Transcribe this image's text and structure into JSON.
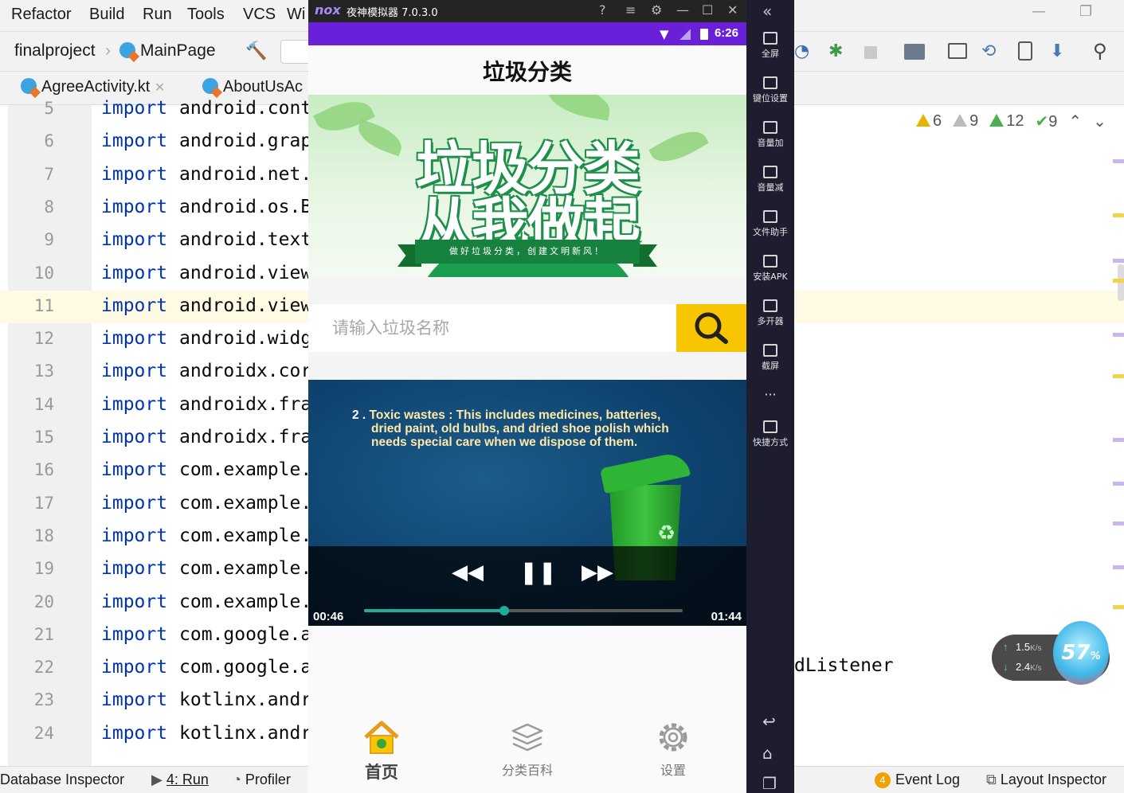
{
  "ide": {
    "menu": [
      "Refactor",
      "Build",
      "Run",
      "Tools",
      "VCS",
      "Wi"
    ],
    "breadcrumb": {
      "project": "finalproject",
      "file": "MainPage"
    },
    "tabs": [
      "AgreeActivity.kt",
      "AboutUsAc"
    ],
    "code_lines": [
      {
        "n": "5",
        "kw": "import",
        "code": "android.cont"
      },
      {
        "n": "6",
        "kw": "import",
        "code": "android.grap"
      },
      {
        "n": "7",
        "kw": "import",
        "code": "android.net."
      },
      {
        "n": "8",
        "kw": "import",
        "code": "android.os.B"
      },
      {
        "n": "9",
        "kw": "import",
        "code": "android.text"
      },
      {
        "n": "10",
        "kw": "import",
        "code": "android.view"
      },
      {
        "n": "11",
        "kw": "import",
        "code": "android.view"
      },
      {
        "n": "12",
        "kw": "import",
        "code": "android.widg"
      },
      {
        "n": "13",
        "kw": "import",
        "code": "androidx.cor"
      },
      {
        "n": "14",
        "kw": "import",
        "code": "androidx.fra"
      },
      {
        "n": "15",
        "kw": "import",
        "code": "androidx.fra"
      },
      {
        "n": "16",
        "kw": "import",
        "code": "com.example."
      },
      {
        "n": "17",
        "kw": "import",
        "code": "com.example."
      },
      {
        "n": "18",
        "kw": "import",
        "code": "com.example."
      },
      {
        "n": "19",
        "kw": "import",
        "code": "com.example."
      },
      {
        "n": "20",
        "kw": "import",
        "code": "com.example."
      },
      {
        "n": "21",
        "kw": "import",
        "code": "com.google.a"
      },
      {
        "n": "22",
        "kw": "import",
        "code": "com.google.a"
      },
      {
        "n": "23",
        "kw": "import",
        "code": "kotlinx.andr"
      },
      {
        "n": "24",
        "kw": "import",
        "code": "kotlinx.andr"
      }
    ],
    "ext_code": "dListener",
    "inspections": {
      "warnings": "6",
      "weak_warnings": "9",
      "typos": "12",
      "ok": "9"
    },
    "status": {
      "db": "Database Inspector",
      "run": "4: Run",
      "profiler": "Profiler",
      "event_count": "4",
      "event_log": "Event Log",
      "layout_inspector": "Layout Inspector"
    }
  },
  "emulator": {
    "title": "夜神模拟器 7.0.3.0",
    "logo": "nox",
    "time": "6:26",
    "sidebar": [
      "全屏",
      "键位设置",
      "音量加",
      "音量减",
      "文件助手",
      "安装APK",
      "多开器",
      "截屏",
      "快捷方式"
    ],
    "more": "···",
    "speed": {
      "up": "1.5",
      "down": "2.4",
      "unit": "K/s",
      "percent": "57"
    }
  },
  "app": {
    "title": "垃圾分类",
    "banner": {
      "line1": "垃圾分类",
      "line2": "从我做起",
      "ribbon": "做好垃圾分类，创建文明新风！"
    },
    "search": {
      "placeholder": "请输入垃圾名称"
    },
    "video": {
      "caption_num": "2 .",
      "caption_l1": "Toxic wastes : This includes medicines, batteries,",
      "caption_l2": "dried paint, old bulbs, and dried shoe polish which",
      "caption_l3": "needs special care when we dispose of them.",
      "current": "00:46",
      "total": "01:44",
      "progress": 0.44
    },
    "nav": [
      {
        "label": "首页",
        "icon": "home-icon"
      },
      {
        "label": "分类百科",
        "icon": "layers-icon"
      },
      {
        "label": "设置",
        "icon": "settings-icon"
      }
    ]
  },
  "colors": {
    "accent": "#f7c600",
    "statusbar": "#6a1fd8",
    "seek": "#1eae9a",
    "keyword": "#0033b3"
  }
}
